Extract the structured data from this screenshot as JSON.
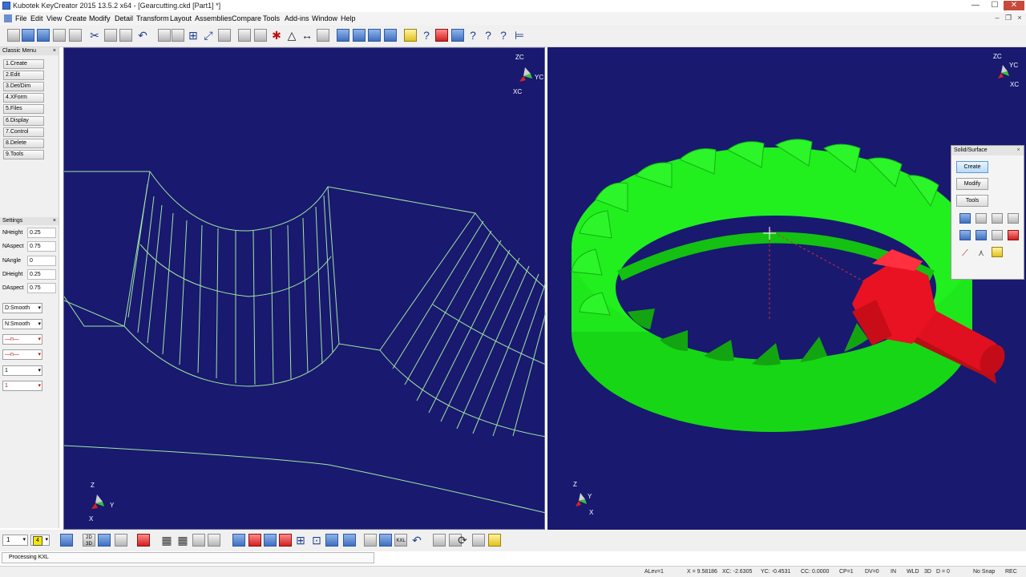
{
  "app": {
    "window_title": "Kubotek KeyCreator 2015 13.5.2 x64 - [Gearcutting.ckd [Part1] *]"
  },
  "window_controls": {
    "minimize": "—",
    "maximize": "☐",
    "close": "✕"
  },
  "menu": {
    "items": [
      "File",
      "Edit",
      "View",
      "Create",
      "Modify",
      "Detail",
      "Transform",
      "Layout",
      "Assemblies",
      "Compare",
      "Tools",
      "Add-ins",
      "Window",
      "Help"
    ]
  },
  "classic_menu": {
    "title": "Classic Menu",
    "close": "×",
    "items": [
      "1.Create",
      "2.Edit",
      "3.Det/Dim",
      "4.XForm",
      "5.Files",
      "6.Display",
      "7.Control",
      "8.Delete",
      "9.Tools"
    ]
  },
  "settings": {
    "title": "Settings",
    "close": "×",
    "rows": [
      {
        "label": "NHeight",
        "value": "0.25"
      },
      {
        "label": "NAspect",
        "value": "0.75"
      },
      {
        "label": "NAngle",
        "value": "0"
      },
      {
        "label": "DHeight",
        "value": "0.25"
      },
      {
        "label": "DAspect",
        "value": "0.75"
      }
    ],
    "selects": [
      "D:Smooth",
      "N:Smooth",
      "—n—",
      "—n—",
      "1",
      "1"
    ]
  },
  "left_view": {
    "triad_top": {
      "z": "ZC",
      "y": "YC",
      "x": "XC"
    },
    "triad_bottom": {
      "z": "Z",
      "y": "Y",
      "x": "X"
    },
    "background": "#191970",
    "wire_color": "#9fe7a0"
  },
  "right_view": {
    "triad_top": {
      "z": "ZC",
      "y": "YC",
      "x": "XC"
    },
    "triad_bottom": {
      "z": "Z",
      "y": "Y",
      "x": "X"
    },
    "gear_color": "#21f01e",
    "pinion_color": "#e01020"
  },
  "solid_surface_panel": {
    "title": "Solid/Surface",
    "close": "×",
    "buttons": [
      "Create",
      "Modify",
      "Tools"
    ]
  },
  "bottom_toolbar": {
    "layer_value": "1",
    "color_value": "4"
  },
  "command_line": {
    "text": "Processing KXL"
  },
  "status": {
    "alev": "ALev=1",
    "x": "X = 9.58186",
    "xc": "XC: -2.6305",
    "yc": "YC: -0.4531",
    "cc": "CC: 0.0000",
    "cp": "CP=1",
    "dv": "DV=0",
    "in": "IN",
    "wld": "WLD",
    "mode": "3D",
    "d": "D = 0",
    "snap": "No Snap",
    "rec": "REC"
  }
}
